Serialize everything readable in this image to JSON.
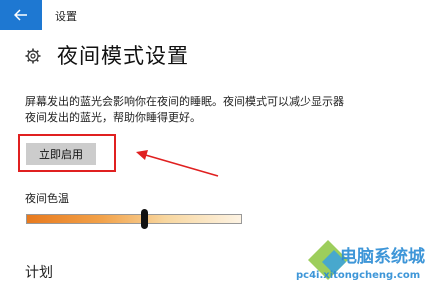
{
  "header": {
    "back_icon": "arrow-left-icon",
    "title": "设置",
    "accent_color": "#1e78d2"
  },
  "page": {
    "icon": "gear-icon",
    "title": "夜间模式设置",
    "description_line1": "屏幕发出的蓝光会影响你在夜间的睡眠。夜间模式可以减少显示器",
    "description_line2": "夜间发出的蓝光，帮助你睡得更好。"
  },
  "enable_button": {
    "label": "立即启用",
    "highlight_color": "#e02020"
  },
  "color_temperature": {
    "label": "夜间色温",
    "level": 0.55
  },
  "schedule": {
    "label": "计划"
  },
  "watermark": {
    "line1": "电脑系统城",
    "line2": "pc4i.xitongcheng.com"
  }
}
